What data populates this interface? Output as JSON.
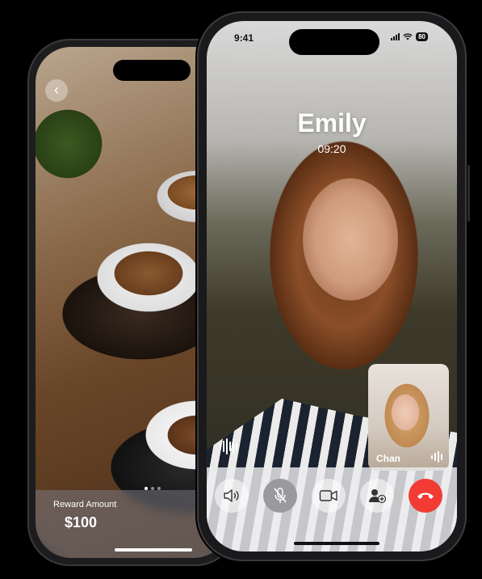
{
  "back_phone": {
    "nav_icon": "chevron-left-icon",
    "nav_glyph": "‹",
    "reward": {
      "label": "Reward Amount",
      "amount": "$100"
    },
    "pagination": {
      "total": 3,
      "active_index": 0
    }
  },
  "front_phone": {
    "status_bar": {
      "time": "9:41",
      "battery": "80"
    },
    "call": {
      "caller_name": "Emily",
      "duration": "09:20"
    },
    "pip": {
      "name": "Chan"
    },
    "controls": [
      {
        "name": "speaker-button",
        "icon": "speaker-icon"
      },
      {
        "name": "mute-button",
        "icon": "mic-off-icon",
        "active": true
      },
      {
        "name": "video-button",
        "icon": "video-camera-icon"
      },
      {
        "name": "add-participant-button",
        "icon": "add-person-icon"
      },
      {
        "name": "end-call-button",
        "icon": "phone-hangup-icon",
        "color": "#f23b35"
      }
    ]
  },
  "colors": {
    "accent_end_call": "#f23b35",
    "reward_button": "#1e7cf2"
  }
}
